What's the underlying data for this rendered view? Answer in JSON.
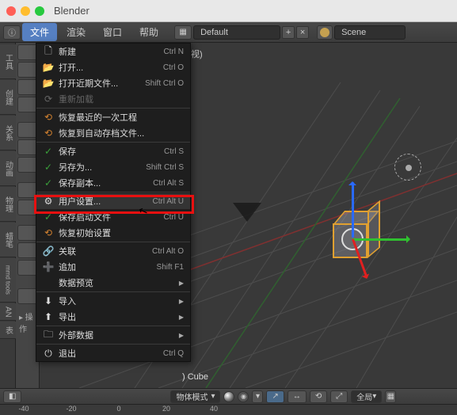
{
  "app_title": "Blender",
  "topbar": {
    "menus": [
      "文件",
      "渲染",
      "窗口",
      "帮助"
    ],
    "layout": "Default",
    "scene_label": "Scene"
  },
  "left_tabs": [
    "工具",
    "创建",
    "关系",
    "动画",
    "物理",
    "蜡笔",
    "mmd tools",
    "AN",
    "表"
  ],
  "tool_panel_label": "▸ 操作",
  "viewport": {
    "perspective": "透视)",
    "object_label": ") Cube"
  },
  "file_menu": {
    "new": {
      "label": "新建",
      "shortcut": "Ctrl N"
    },
    "open": {
      "label": "打开...",
      "shortcut": "Ctrl O"
    },
    "open_recent": {
      "label": "打开近期文件...",
      "shortcut": "Shift Ctrl O"
    },
    "reload": {
      "label": "重新加载"
    },
    "recover_last": {
      "label": "恢复最近的一次工程"
    },
    "recover_auto": {
      "label": "恢复到自动存档文件..."
    },
    "save": {
      "label": "保存",
      "shortcut": "Ctrl S"
    },
    "save_as": {
      "label": "另存为...",
      "shortcut": "Shift Ctrl S"
    },
    "save_copy": {
      "label": "保存副本...",
      "shortcut": "Ctrl Alt S"
    },
    "user_prefs": {
      "label": "用户设置...",
      "shortcut": "Ctrl Alt U"
    },
    "save_startup": {
      "label": "保存启动文件",
      "shortcut": "Ctrl U"
    },
    "restore_factory": {
      "label": "恢复初始设置"
    },
    "link": {
      "label": "关联",
      "shortcut": "Ctrl Alt O"
    },
    "append": {
      "label": "追加",
      "shortcut": "Shift F1"
    },
    "data_preview": {
      "label": "数据预览"
    },
    "import": {
      "label": "导入"
    },
    "export": {
      "label": "导出"
    },
    "external_data": {
      "label": "外部数据"
    },
    "quit": {
      "label": "退出",
      "shortcut": "Ctrl Q"
    }
  },
  "bottombar": {
    "mode": "物体模式",
    "scope": "全局"
  },
  "ruler": [
    "-40",
    "-20",
    "0",
    "20",
    "40"
  ]
}
